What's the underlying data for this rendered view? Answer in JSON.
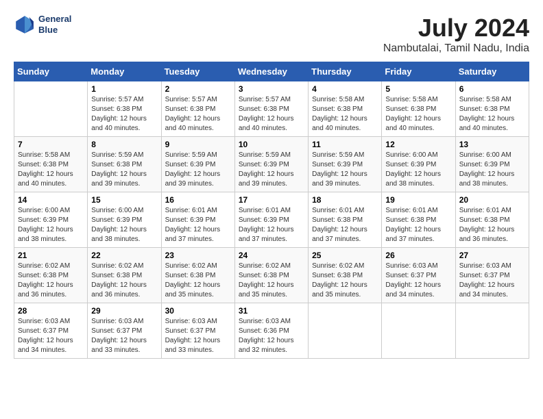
{
  "header": {
    "logo_line1": "General",
    "logo_line2": "Blue",
    "month_year": "July 2024",
    "location": "Nambutalai, Tamil Nadu, India"
  },
  "weekdays": [
    "Sunday",
    "Monday",
    "Tuesday",
    "Wednesday",
    "Thursday",
    "Friday",
    "Saturday"
  ],
  "weeks": [
    [
      {
        "day": "",
        "info": ""
      },
      {
        "day": "1",
        "info": "Sunrise: 5:57 AM\nSunset: 6:38 PM\nDaylight: 12 hours\nand 40 minutes."
      },
      {
        "day": "2",
        "info": "Sunrise: 5:57 AM\nSunset: 6:38 PM\nDaylight: 12 hours\nand 40 minutes."
      },
      {
        "day": "3",
        "info": "Sunrise: 5:57 AM\nSunset: 6:38 PM\nDaylight: 12 hours\nand 40 minutes."
      },
      {
        "day": "4",
        "info": "Sunrise: 5:58 AM\nSunset: 6:38 PM\nDaylight: 12 hours\nand 40 minutes."
      },
      {
        "day": "5",
        "info": "Sunrise: 5:58 AM\nSunset: 6:38 PM\nDaylight: 12 hours\nand 40 minutes."
      },
      {
        "day": "6",
        "info": "Sunrise: 5:58 AM\nSunset: 6:38 PM\nDaylight: 12 hours\nand 40 minutes."
      }
    ],
    [
      {
        "day": "7",
        "info": "Sunrise: 5:58 AM\nSunset: 6:38 PM\nDaylight: 12 hours\nand 40 minutes."
      },
      {
        "day": "8",
        "info": "Sunrise: 5:59 AM\nSunset: 6:38 PM\nDaylight: 12 hours\nand 39 minutes."
      },
      {
        "day": "9",
        "info": "Sunrise: 5:59 AM\nSunset: 6:39 PM\nDaylight: 12 hours\nand 39 minutes."
      },
      {
        "day": "10",
        "info": "Sunrise: 5:59 AM\nSunset: 6:39 PM\nDaylight: 12 hours\nand 39 minutes."
      },
      {
        "day": "11",
        "info": "Sunrise: 5:59 AM\nSunset: 6:39 PM\nDaylight: 12 hours\nand 39 minutes."
      },
      {
        "day": "12",
        "info": "Sunrise: 6:00 AM\nSunset: 6:39 PM\nDaylight: 12 hours\nand 38 minutes."
      },
      {
        "day": "13",
        "info": "Sunrise: 6:00 AM\nSunset: 6:39 PM\nDaylight: 12 hours\nand 38 minutes."
      }
    ],
    [
      {
        "day": "14",
        "info": "Sunrise: 6:00 AM\nSunset: 6:39 PM\nDaylight: 12 hours\nand 38 minutes."
      },
      {
        "day": "15",
        "info": "Sunrise: 6:00 AM\nSunset: 6:39 PM\nDaylight: 12 hours\nand 38 minutes."
      },
      {
        "day": "16",
        "info": "Sunrise: 6:01 AM\nSunset: 6:39 PM\nDaylight: 12 hours\nand 37 minutes."
      },
      {
        "day": "17",
        "info": "Sunrise: 6:01 AM\nSunset: 6:39 PM\nDaylight: 12 hours\nand 37 minutes."
      },
      {
        "day": "18",
        "info": "Sunrise: 6:01 AM\nSunset: 6:38 PM\nDaylight: 12 hours\nand 37 minutes."
      },
      {
        "day": "19",
        "info": "Sunrise: 6:01 AM\nSunset: 6:38 PM\nDaylight: 12 hours\nand 37 minutes."
      },
      {
        "day": "20",
        "info": "Sunrise: 6:01 AM\nSunset: 6:38 PM\nDaylight: 12 hours\nand 36 minutes."
      }
    ],
    [
      {
        "day": "21",
        "info": "Sunrise: 6:02 AM\nSunset: 6:38 PM\nDaylight: 12 hours\nand 36 minutes."
      },
      {
        "day": "22",
        "info": "Sunrise: 6:02 AM\nSunset: 6:38 PM\nDaylight: 12 hours\nand 36 minutes."
      },
      {
        "day": "23",
        "info": "Sunrise: 6:02 AM\nSunset: 6:38 PM\nDaylight: 12 hours\nand 35 minutes."
      },
      {
        "day": "24",
        "info": "Sunrise: 6:02 AM\nSunset: 6:38 PM\nDaylight: 12 hours\nand 35 minutes."
      },
      {
        "day": "25",
        "info": "Sunrise: 6:02 AM\nSunset: 6:38 PM\nDaylight: 12 hours\nand 35 minutes."
      },
      {
        "day": "26",
        "info": "Sunrise: 6:03 AM\nSunset: 6:37 PM\nDaylight: 12 hours\nand 34 minutes."
      },
      {
        "day": "27",
        "info": "Sunrise: 6:03 AM\nSunset: 6:37 PM\nDaylight: 12 hours\nand 34 minutes."
      }
    ],
    [
      {
        "day": "28",
        "info": "Sunrise: 6:03 AM\nSunset: 6:37 PM\nDaylight: 12 hours\nand 34 minutes."
      },
      {
        "day": "29",
        "info": "Sunrise: 6:03 AM\nSunset: 6:37 PM\nDaylight: 12 hours\nand 33 minutes."
      },
      {
        "day": "30",
        "info": "Sunrise: 6:03 AM\nSunset: 6:37 PM\nDaylight: 12 hours\nand 33 minutes."
      },
      {
        "day": "31",
        "info": "Sunrise: 6:03 AM\nSunset: 6:36 PM\nDaylight: 12 hours\nand 32 minutes."
      },
      {
        "day": "",
        "info": ""
      },
      {
        "day": "",
        "info": ""
      },
      {
        "day": "",
        "info": ""
      }
    ]
  ]
}
